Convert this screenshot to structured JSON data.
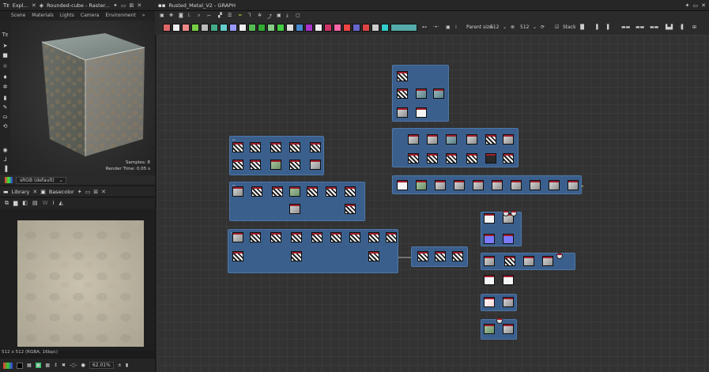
{
  "left_panel": {
    "tabs": [
      {
        "label": "Expl..."
      },
      {
        "label": "Rounded-cube - Raster..."
      }
    ],
    "menu": [
      "Scene",
      "Materials",
      "Lights",
      "Camera",
      "Environment"
    ],
    "menu_more": "»",
    "render_stats": {
      "samples": "Samples: 8",
      "render_time": "Render Time: 0.05 s"
    },
    "color_space": "sRGB (default)"
  },
  "library_panel": {
    "tabs": [
      {
        "label": "Library"
      },
      {
        "label": "Basecolor"
      }
    ],
    "texture_info": "512 x 512 (RGBA, 16bpc)",
    "zoom": "62.01%"
  },
  "graph_panel": {
    "title": "Rusted_Metal_V2 - GRAPH",
    "parent_size_label": "Parent size:",
    "parent_size_value": "512",
    "size_value": "512",
    "stack_label": "Stack"
  },
  "colors": {
    "frame_blue": "#3b5f8c",
    "node_header_red": "#a31f2e",
    "canvas_bg": "#323232",
    "panel_bg": "#262626"
  },
  "icons": [
    "close-icon",
    "pin-icon",
    "maximize-icon",
    "cube-icon",
    "gear-icon",
    "zoom-icon"
  ]
}
